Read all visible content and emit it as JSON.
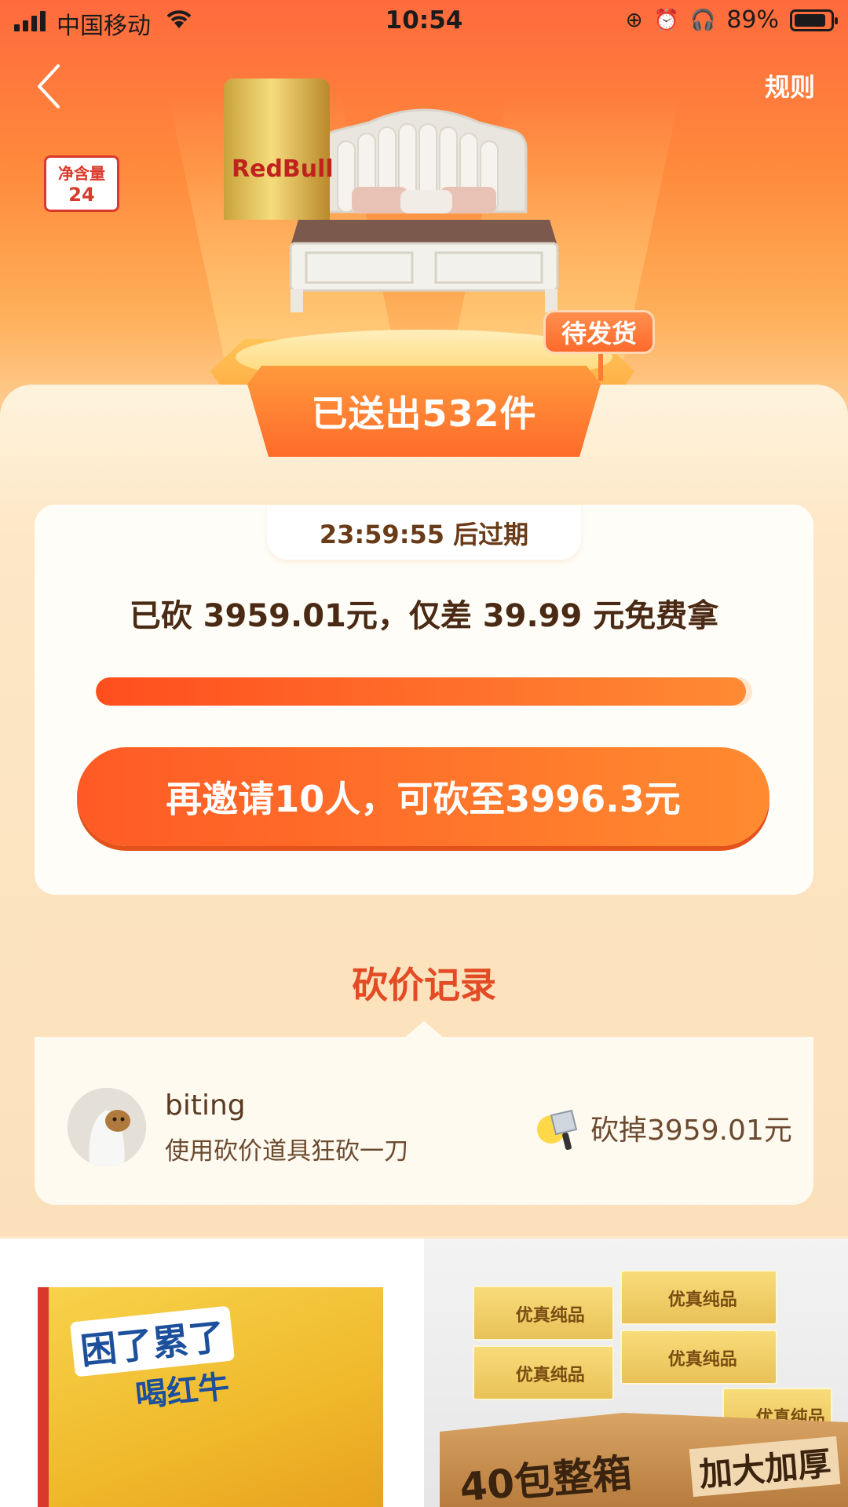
{
  "status_bar": {
    "carrier": "中国移动",
    "time": "10:54",
    "battery": "89%",
    "battery_level": 0.89
  },
  "nav": {
    "back_icon": "chevron-left-icon",
    "rules_label": "规则"
  },
  "prize": {
    "image": "bed-product-image",
    "ship_badge": "待发货",
    "sent_label": "已送出532件"
  },
  "progress": {
    "expire_label": "23:59:55 后过期",
    "status_text": "已砍 3959.01元，仅差 39.99 元免费拿",
    "fraction": 0.99,
    "invite_button": "再邀请10人，可砍至3996.3元"
  },
  "records": {
    "title": "砍价记录",
    "items": [
      {
        "user": "biting",
        "action": "使用砍价道具狂砍一刀",
        "icon": "cleaver-icon",
        "amount": "砍掉3959.01元"
      }
    ]
  },
  "products": [
    {
      "image": "red-bull-product-image",
      "slogan_a": "困了累了",
      "slogan_b": "喝红牛",
      "volume_label": "净含量",
      "volume_value": "24",
      "brand": "RedBull"
    },
    {
      "image": "tissue-box-product-image",
      "brand": "优真纯品",
      "text_a": "40包整箱",
      "text_b": "加大加厚"
    }
  ],
  "colors": {
    "accent": "#ff5a25",
    "record_title": "#e24b25",
    "panel": "#fde7c6"
  }
}
